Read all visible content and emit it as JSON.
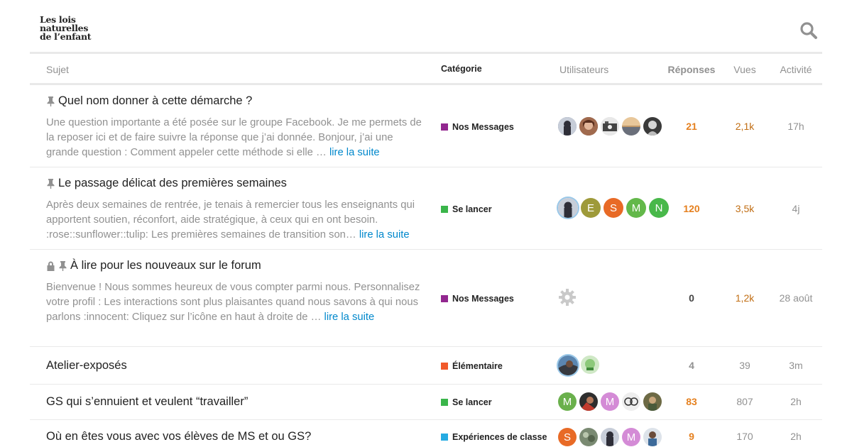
{
  "logo": {
    "line1": "Les lois",
    "line2": "naturelles",
    "line3": "de l’enfant"
  },
  "icons": {
    "search": "search-icon",
    "pin": "pin-icon",
    "lock": "lock-icon",
    "system": "gear-icon"
  },
  "headers": {
    "sujet": "Sujet",
    "categorie": "Catégorie",
    "utilisateurs": "Utilisateurs",
    "reponses": "Réponses",
    "vues": "Vues",
    "activite": "Activité"
  },
  "categories": {
    "nos_messages": {
      "name": "Nos Messages",
      "color": "#92278f"
    },
    "se_lancer": {
      "name": "Se lancer",
      "color": "#3ab54a"
    },
    "elementaire": {
      "name": "Élémentaire",
      "color": "#f1592a"
    },
    "experiences": {
      "name": "Expériences de classe",
      "color": "#25aae2"
    }
  },
  "accent": "#0088cc",
  "topics": [
    {
      "title": "Quel nom donner à cette démarche ?",
      "excerpt": "Une question importante a été posée sur le groupe Facebook. Je me permets de la reposer ici et de faire suivre la réponse que j’ai donnée. Bonjour, j’ai une grande question : Comment appeler cette méthode si elle …",
      "more": "lire la suite",
      "category": "Nos Messages",
      "replies": "21",
      "views": "2,1k",
      "activity": "17h"
    },
    {
      "title": "Le passage délicat des premières semaines",
      "excerpt": "Après deux semaines de rentrée, je tenais à remercier tous les enseignants qui apportent soutien, réconfort, aide stratégique, à ceux qui en ont besoin. :rose::sunflower::tulip: Les premières semaines de transition son…",
      "more": "lire la suite",
      "category": "Se lancer",
      "avatar_letters": [
        "E",
        "S",
        "M",
        "N"
      ],
      "replies": "120",
      "views": "3,5k",
      "activity": "4j"
    },
    {
      "title": "À lire pour les nouveaux sur le forum",
      "excerpt": "Bienvenue ! Nous sommes heureux de vous compter parmi nous. Personnalisez votre profil : Les interactions sont plus plaisantes quand nous savons à qui nous parlons :innocent: Cliquez sur l’icône en haut à droite de …",
      "more": "lire la suite",
      "category": "Nos Messages",
      "replies": "0",
      "views": "1,2k",
      "activity": "28 août"
    },
    {
      "title": "Atelier-exposés",
      "category": "Élémentaire",
      "replies": "4",
      "views": "39",
      "activity": "3m"
    },
    {
      "title": "GS qui s’ennuient et veulent “travailler”",
      "category": "Se lancer",
      "avatar_letters": [
        "M",
        "M"
      ],
      "replies": "83",
      "views": "807",
      "activity": "2h"
    },
    {
      "title": "Où en êtes vous avec vos élèves de MS et ou GS?",
      "category": "Expériences de classe",
      "avatar_letters": [
        "S",
        "M"
      ],
      "replies": "9",
      "views": "170",
      "activity": "2h"
    }
  ]
}
